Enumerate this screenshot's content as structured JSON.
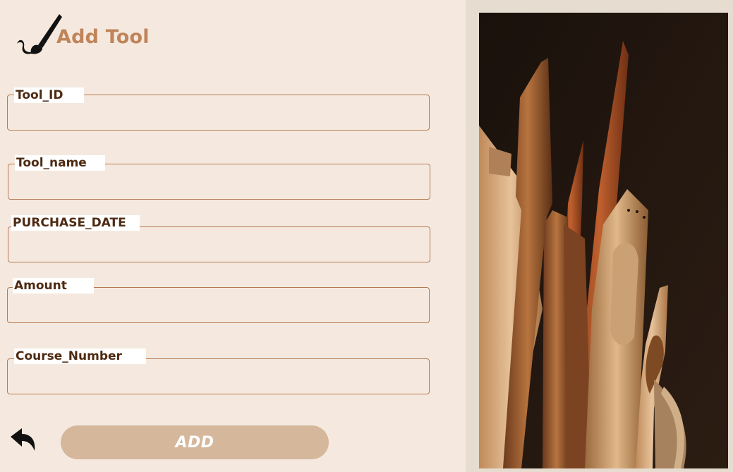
{
  "header": {
    "title": "Add Tool",
    "icon": "paintbrush-icon"
  },
  "form": {
    "fields": [
      {
        "label": "Tool_ID",
        "value": ""
      },
      {
        "label": "Tool_name",
        "value": ""
      },
      {
        "label": "PURCHASE_DATE",
        "value": ""
      },
      {
        "label": "Amount",
        "value": ""
      },
      {
        "label": "Course_Number",
        "value": ""
      }
    ]
  },
  "actions": {
    "add_label": "ADD",
    "back_icon": "back-arrow-icon"
  },
  "colors": {
    "background": "#f5e9df",
    "accent": "#c0845a",
    "label_text": "#4e2a12",
    "button": "#d5b79c",
    "border": "#b47a52"
  }
}
